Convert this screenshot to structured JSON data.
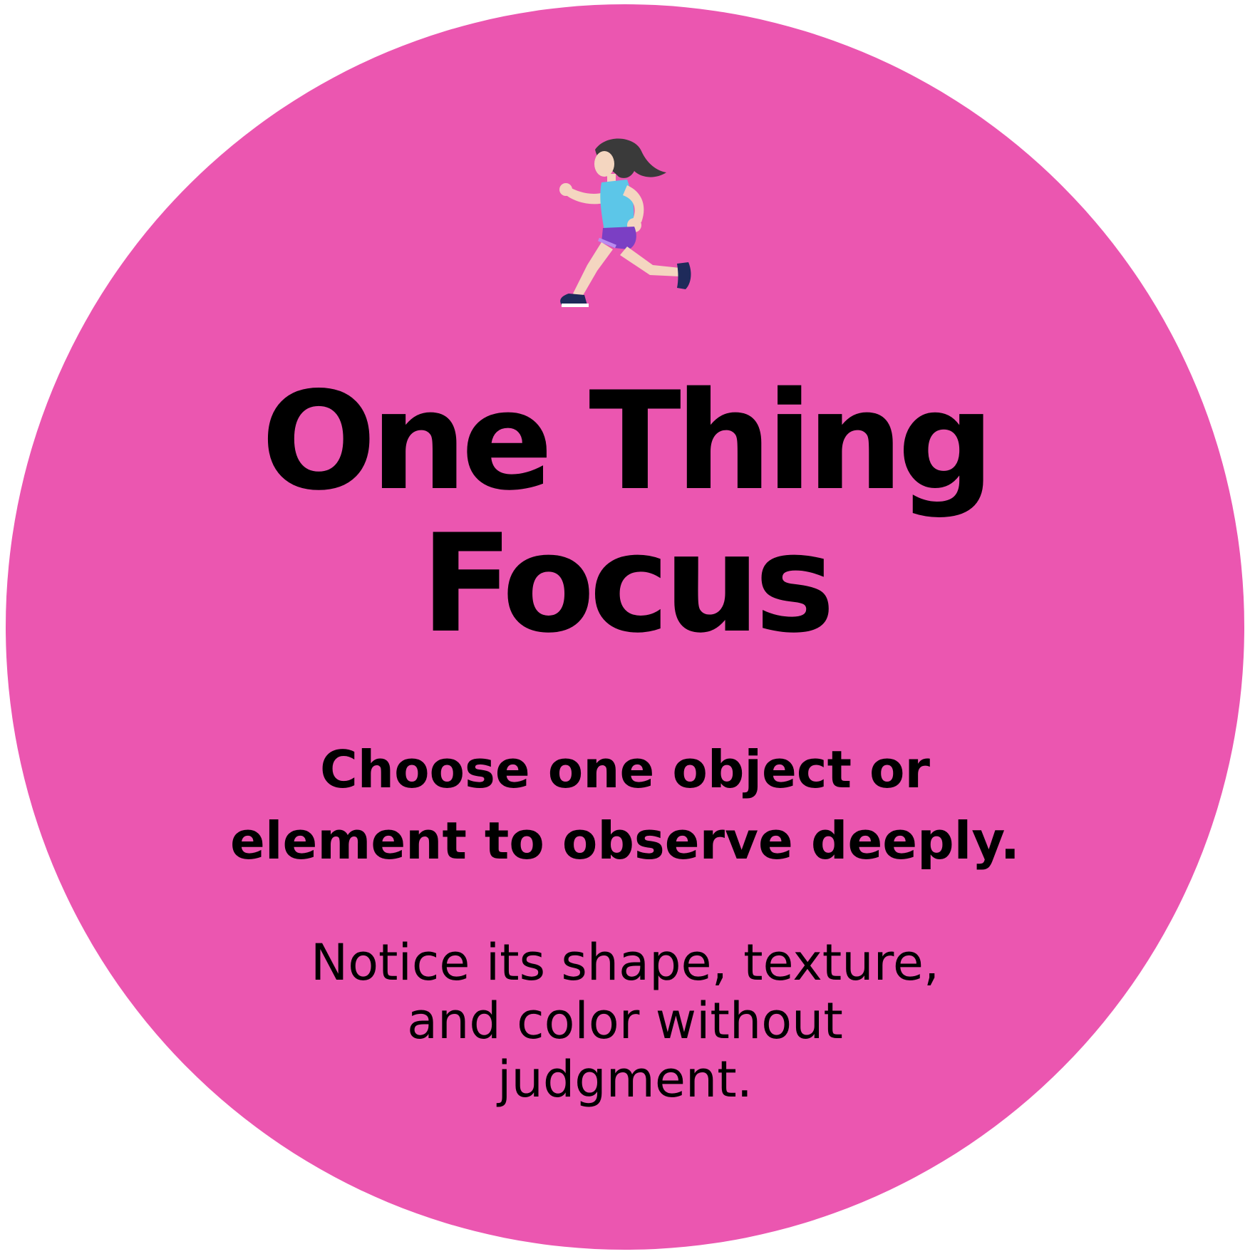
{
  "card": {
    "background_color": "#EB56B0",
    "icon": "woman-running-icon",
    "title_lines": [
      "One Thing",
      "Focus"
    ],
    "subtitle_lines": [
      "Choose one object or",
      "element to observe deeply."
    ],
    "body_lines": [
      "Notice its shape, texture,",
      "and color without",
      "judgment."
    ]
  }
}
